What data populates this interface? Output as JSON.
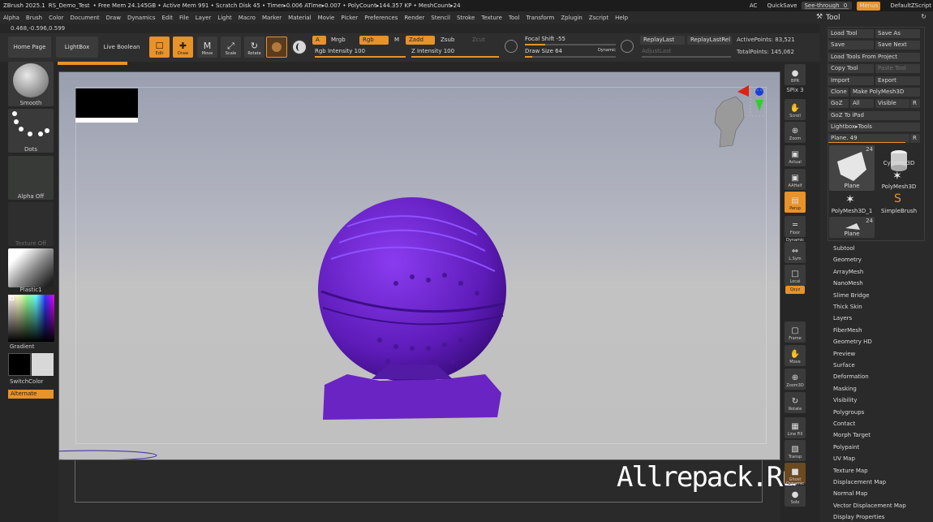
{
  "titlebar": {
    "app": "ZBrush 2025.1",
    "project": "RS_Demo_Test",
    "stats": "• Free Mem 24.145GB • Active Mem 991 • Scratch Disk 45 • Timer▸0.006 ATime▸0.007 • PolyCount▸144.357 KP • MeshCount▸24",
    "ac": "AC",
    "quicksave": "QuickSave",
    "see_through_label": "See-through",
    "see_through_value": "0",
    "menus": "Menus",
    "default_zscript": "DefaultZScript"
  },
  "menubar": [
    "Alpha",
    "Brush",
    "Color",
    "Document",
    "Draw",
    "Dynamics",
    "Edit",
    "File",
    "Layer",
    "Light",
    "Macro",
    "Marker",
    "Material",
    "Movie",
    "Picker",
    "Preferences",
    "Render",
    "Stencil",
    "Stroke",
    "Texture",
    "Tool",
    "Transform",
    "Zplugin",
    "Zscript",
    "Help"
  ],
  "coords": "0.468,-0.596,0.599",
  "shelf": {
    "home": "Home Page",
    "lightbox": "LightBox",
    "live_boolean": "Live Boolean",
    "tools": [
      {
        "label": "Edit",
        "icon": "edit-icon",
        "glyph": "☐"
      },
      {
        "label": "Draw",
        "icon": "draw-icon",
        "glyph": "✚"
      },
      {
        "label": "Move",
        "icon": "move-icon",
        "glyph": "M"
      },
      {
        "label": "Scale",
        "icon": "scale-icon",
        "glyph": "⤢"
      },
      {
        "label": "Rotate",
        "icon": "rotate-icon",
        "glyph": "↻"
      }
    ],
    "a": "A",
    "mrgb": "Mrgb",
    "rgb": "Rgb",
    "m": "M",
    "zadd": "Zadd",
    "zsub": "Zsub",
    "zcut": "Zcut",
    "rgb_intensity": "Rgb Intensity 100",
    "z_intensity": "Z Intensity 100",
    "focal_shift": "Focal Shift -55",
    "draw_size": "Draw Size 64",
    "dynamic": "Dynamic",
    "replay_last": "ReplayLast",
    "replay_last_rel": "ReplayLastRel",
    "adjust_last": "AdjustLast",
    "active_points": "ActivePoints: 83,521",
    "total_points": "TotalPoints: 145,062"
  },
  "lefttray": {
    "smooth": "Smooth",
    "dots": "Dots",
    "alpha_off": "Alpha Off",
    "texture_off": "Texture Off",
    "material": "Plastic1",
    "gradient": "Gradient",
    "switch_color": "SwitchColor",
    "alternate": "Alternate"
  },
  "watermark": "Allrepack.Ru",
  "right_column": [
    {
      "label": "BPR",
      "icon": "bpr-icon",
      "glyph": "●"
    },
    {
      "label": "SPix 3",
      "icon": "spix-icon",
      "glyph": ""
    },
    {
      "label": "Scroll",
      "icon": "scroll-icon",
      "glyph": "✋"
    },
    {
      "label": "Zoom",
      "icon": "zoom-icon",
      "glyph": "⊕"
    },
    {
      "label": "Actual",
      "icon": "actual-icon",
      "glyph": "▣"
    },
    {
      "label": "AAHalf",
      "icon": "aahalf-icon",
      "glyph": "▣"
    },
    {
      "label": "Persp",
      "icon": "persp-icon",
      "glyph": "▤"
    },
    {
      "label": "Floor",
      "icon": "floor-icon",
      "glyph": "═"
    },
    {
      "label": "L.Sym",
      "icon": "lsym-icon",
      "glyph": "⇔"
    },
    {
      "label": "Local",
      "icon": "lock-icon",
      "glyph": "□"
    },
    {
      "label": "Frame",
      "icon": "frame-icon",
      "glyph": "▢"
    },
    {
      "label": "Move",
      "icon": "move-hand-icon",
      "glyph": "✋"
    },
    {
      "label": "Zoom3D",
      "icon": "zoom3d-icon",
      "glyph": "⊕"
    },
    {
      "label": "Rotate",
      "icon": "rotate3d-icon",
      "glyph": "↻"
    },
    {
      "label": "Line Fill",
      "icon": "linefill-icon",
      "glyph": "▦"
    },
    {
      "label": "Transp",
      "icon": "transp-icon",
      "glyph": "▧"
    },
    {
      "label": "Ghost",
      "icon": "ghost-icon",
      "glyph": "■"
    },
    {
      "label": "Solo",
      "icon": "solo-icon",
      "glyph": "●"
    }
  ],
  "right_column_extra": {
    "dynamic": "Dynamic",
    "xyz": "Qxyz",
    "line_fill": "Line Fill",
    "dynamic2": "Dynamic"
  },
  "tool_palette": {
    "title": "Tool",
    "load_tool": "Load Tool",
    "save_as": "Save As",
    "save": "Save",
    "save_next": "Save Next",
    "load_from_project": "Load Tools From Project",
    "copy_tool": "Copy Tool",
    "paste_tool": "Paste Tool",
    "import": "Import",
    "export": "Export",
    "clone": "Clone",
    "make_polymesh": "Make PolyMesh3D",
    "goz": "GoZ",
    "all": "All",
    "visible": "Visible",
    "r": "R",
    "goz_ipad": "GoZ To iPad",
    "lightbox_tools": "Lightbox▸Tools",
    "plane_slider": "Plane. 49",
    "meshes": [
      {
        "name": "Plane",
        "count": "24"
      },
      {
        "name": "Cylinder3D",
        "count": ""
      },
      {
        "name": "PolyMesh3D",
        "count": ""
      },
      {
        "name": "PolyMesh3D_1",
        "count": ""
      },
      {
        "name": "SimpleBrush",
        "count": ""
      },
      {
        "name": "Plane",
        "count": "24"
      }
    ],
    "subpalettes": [
      "Subtool",
      "Geometry",
      "ArrayMesh",
      "NanoMesh",
      "Slime Bridge",
      "Thick Skin",
      "Layers",
      "FiberMesh",
      "Geometry HD",
      "Preview",
      "Surface",
      "Deformation",
      "Masking",
      "Visibility",
      "Polygroups",
      "Contact",
      "Morph Target",
      "Polypaint",
      "UV Map",
      "Texture Map",
      "Displacement Map",
      "Normal Map",
      "Vector Displacement Map",
      "Display Properties"
    ]
  },
  "colors": {
    "accent": "#e8922a",
    "mesh": "#6a24c4",
    "bg": "#262626"
  }
}
